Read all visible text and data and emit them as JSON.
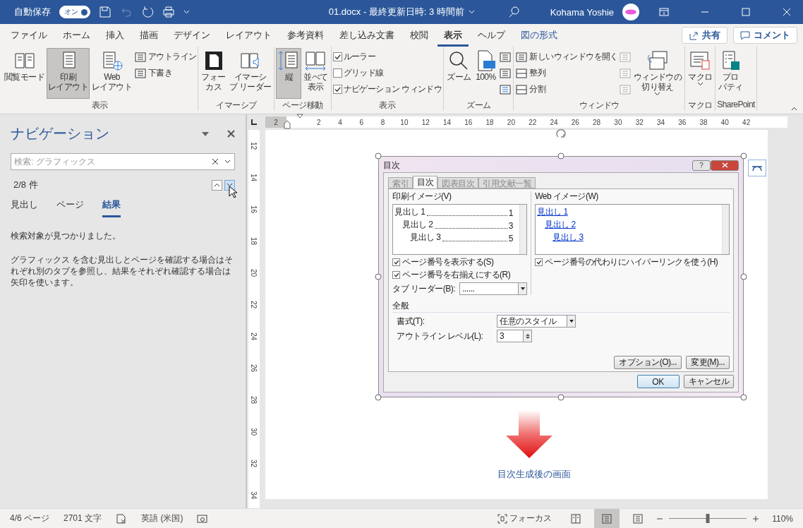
{
  "title_bar": {
    "autosave_label": "自動保存",
    "autosave": {
      "label": "オン",
      "on": true
    },
    "title": "01.docx - 最終更新日時: 3 時間前",
    "user": "Kohama Yoshie"
  },
  "menu_tabs": [
    {
      "label": "ファイル",
      "selected": false,
      "kind": "normal"
    },
    {
      "label": "ホーム",
      "selected": false,
      "kind": "normal"
    },
    {
      "label": "挿入",
      "selected": false,
      "kind": "normal"
    },
    {
      "label": "描画",
      "selected": false,
      "kind": "normal"
    },
    {
      "label": "デザイン",
      "selected": false,
      "kind": "normal"
    },
    {
      "label": "レイアウト",
      "selected": false,
      "kind": "normal"
    },
    {
      "label": "参考資料",
      "selected": false,
      "kind": "normal"
    },
    {
      "label": "差し込み文書",
      "selected": false,
      "kind": "normal"
    },
    {
      "label": "校閲",
      "selected": false,
      "kind": "normal"
    },
    {
      "label": "表示",
      "selected": true,
      "kind": "normal"
    },
    {
      "label": "ヘルプ",
      "selected": false,
      "kind": "normal"
    },
    {
      "label": "図の形式",
      "selected": false,
      "kind": "contextual"
    }
  ],
  "ribbon_actions": [
    {
      "label": "共有",
      "kind": "share"
    },
    {
      "label": "コメント",
      "kind": "comment"
    }
  ],
  "ribbon_groups": [
    {
      "name": "表示",
      "columns": [
        {
          "kind": "large",
          "label": [
            "閲覧モード"
          ],
          "selected": false
        },
        {
          "kind": "large",
          "label": [
            "印刷",
            "レイアウト"
          ],
          "selected": true
        },
        {
          "kind": "large",
          "label": [
            "Web",
            "レイアウト"
          ],
          "selected": false
        },
        {
          "kind": "stack",
          "items": [
            {
              "kind": "small",
              "label": "アウトライン",
              "disabled": false
            },
            {
              "kind": "small",
              "label": "下書き",
              "disabled": false
            }
          ]
        }
      ]
    },
    {
      "name": "イマーシブ",
      "columns": [
        {
          "kind": "large",
          "label": [
            "フォー",
            "カス"
          ],
          "selected": false
        },
        {
          "kind": "large",
          "label": [
            "イマーシ",
            "ブ リーダー"
          ],
          "selected": false
        }
      ]
    },
    {
      "name": "ページ移動",
      "columns": [
        {
          "kind": "large",
          "label": [
            "縦"
          ],
          "selected": true
        },
        {
          "kind": "large",
          "label": [
            "並べて",
            "表示"
          ],
          "selected": false
        }
      ]
    },
    {
      "name": "表示",
      "columns": [
        {
          "kind": "stack",
          "items": [
            {
              "kind": "check",
              "label": "ルーラー",
              "checked": true
            },
            {
              "kind": "check",
              "label": "グリッド線",
              "checked": false
            },
            {
              "kind": "check",
              "label": "ナビゲーション ウィンドウ",
              "checked": true
            }
          ]
        }
      ]
    },
    {
      "name": "ズーム",
      "columns": [
        {
          "kind": "large",
          "label": [
            "ズーム"
          ],
          "selected": false
        },
        {
          "kind": "large",
          "label": [
            "100%"
          ],
          "selected": false
        },
        {
          "kind": "stack",
          "items": [
            {
              "kind": "icon",
              "disabled": false
            },
            {
              "kind": "icon",
              "disabled": false
            },
            {
              "kind": "icon",
              "disabled": false
            }
          ]
        }
      ]
    },
    {
      "name": "ウィンドウ",
      "columns": [
        {
          "kind": "stack",
          "items": [
            {
              "kind": "small",
              "label": "新しいウィンドウを開く",
              "disabled": false
            },
            {
              "kind": "small",
              "label": "整列",
              "disabled": false
            },
            {
              "kind": "small",
              "label": "分割",
              "disabled": false
            }
          ]
        },
        {
          "kind": "stack",
          "items": [
            {
              "kind": "icon",
              "disabled": true
            },
            {
              "kind": "icon",
              "disabled": true
            },
            {
              "kind": "icon",
              "disabled": true
            }
          ]
        },
        {
          "kind": "large",
          "label": [
            "ウィンドウの",
            "切り替え"
          ],
          "selected": false,
          "dropdown": true
        }
      ]
    },
    {
      "name": "マクロ",
      "columns": [
        {
          "kind": "large",
          "label": [
            "マクロ"
          ],
          "selected": false,
          "dropdown": true
        }
      ]
    },
    {
      "name": "SharePoint",
      "columns": [
        {
          "kind": "large",
          "label": [
            "プロ",
            "パティ"
          ],
          "selected": false
        }
      ]
    }
  ],
  "navigation": {
    "title": "ナビゲーション",
    "search": {
      "placeholder": "検索: グラフィックス"
    },
    "result_count": "2/8 件",
    "tabs": [
      {
        "label": "見出し",
        "selected": false
      },
      {
        "label": "ページ",
        "selected": false
      },
      {
        "label": "結果",
        "selected": true
      }
    ],
    "messages": [
      "検索対象が見つかりました。",
      "グラフィックス を含む見出しとページを確認する場合はそれぞれ別のタブを参照し、結果をそれぞれ確認する場合は矢印を使います。"
    ]
  },
  "document": {
    "ruler_numbers": [
      "2",
      "2",
      "4",
      "6",
      "8",
      "10",
      "12",
      "14",
      "16",
      "18",
      "20",
      "22",
      "24",
      "26",
      "28",
      "30",
      "32",
      "34",
      "36",
      "38",
      "40",
      "42"
    ],
    "vertical_ruler_numbers": [
      "12",
      "14",
      "16",
      "18",
      "20",
      "22",
      "24",
      "26",
      "28",
      "30",
      "32",
      "34"
    ],
    "dialog": {
      "title": "目次",
      "tabs": [
        {
          "label": "索引",
          "selected": false
        },
        {
          "label": "目次",
          "selected": true
        },
        {
          "label": "図表目次",
          "selected": false
        },
        {
          "label": "引用文献一覧",
          "selected": false
        }
      ],
      "print_label": "印刷イメージ(V)",
      "print_entries": [
        {
          "text": "見出し 1",
          "page": "1"
        },
        {
          "text": "見出し 2",
          "page": "3"
        },
        {
          "text": "見出し 3",
          "page": "5"
        }
      ],
      "web_label": "Web イメージ(W)",
      "web_links": [
        "見出し 1",
        "見出し 2",
        "見出し 3"
      ],
      "print_options": [
        {
          "label": "ページ番号を表示する(S)",
          "checked": true
        },
        {
          "label": "ページ番号を右揃えにする(R)",
          "checked": true
        }
      ],
      "web_options": [
        {
          "label": "ページ番号の代わりにハイパーリンクを使う(H)",
          "checked": true
        }
      ],
      "leader_label": "タブ リーダー(B):",
      "leader_value": "......",
      "general_label": "全般",
      "format_label": "書式(T):",
      "format_value": "任意のスタイル",
      "level_label": "アウトライン レベル(L):",
      "level_value": "3",
      "buttons": [
        {
          "label": "オプション(O)...",
          "default": false
        },
        {
          "label": "変更(M)...",
          "default": false
        }
      ],
      "footer_buttons": [
        {
          "label": "OK",
          "default": true
        },
        {
          "label": "キャンセル",
          "default": false
        }
      ]
    },
    "caption": "目次生成後の画面"
  },
  "status_bar": {
    "page": "4/6 ページ",
    "words": "2701 文字",
    "language": "英語 (米国)",
    "focus": "フォーカス",
    "views": [
      {
        "selected": false
      },
      {
        "selected": true
      },
      {
        "selected": false
      }
    ],
    "zoom": {
      "level": 0.5,
      "reading": "110%"
    }
  }
}
